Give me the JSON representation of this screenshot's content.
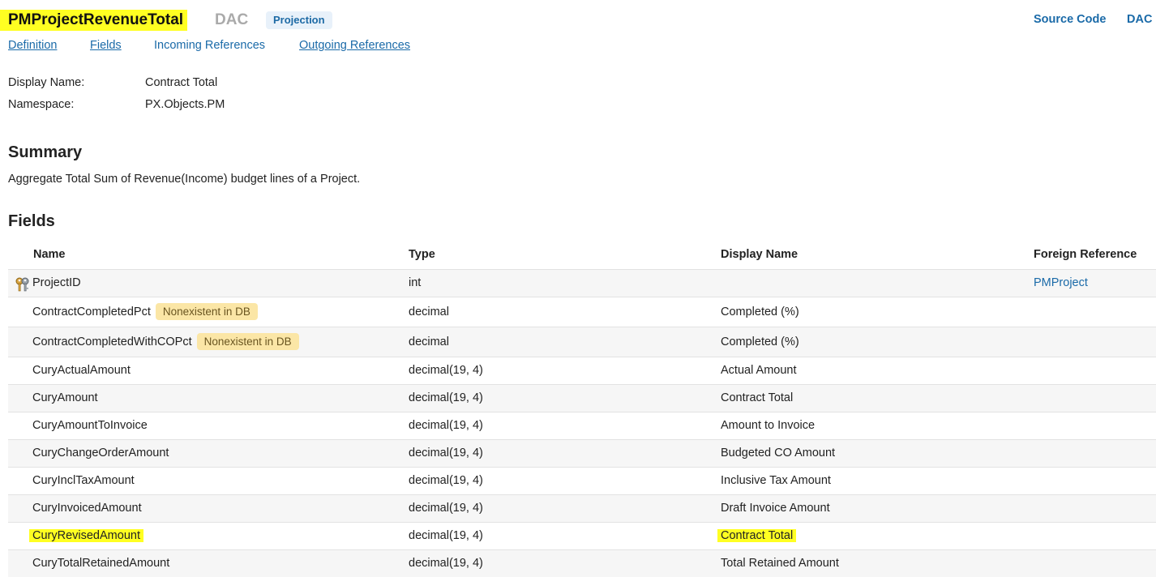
{
  "header": {
    "title": "PMProjectRevenueTotal",
    "kind": "DAC",
    "badge": "Projection",
    "source_code_link": "Source Code",
    "dac_link": "DAC"
  },
  "tabs": [
    {
      "label": "Definition"
    },
    {
      "label": "Fields"
    },
    {
      "label": "Incoming References"
    },
    {
      "label": "Outgoing References"
    }
  ],
  "properties": {
    "display_name_label": "Display Name:",
    "display_name_value": "Contract Total",
    "namespace_label": "Namespace:",
    "namespace_value": "PX.Objects.PM"
  },
  "summary": {
    "heading": "Summary",
    "text": "Aggregate Total Sum of Revenue(Income) budget lines of a Project."
  },
  "fields": {
    "heading": "Fields",
    "columns": [
      "Name",
      "Type",
      "Display Name",
      "Foreign Reference"
    ],
    "rows": [
      {
        "name": "ProjectID",
        "type": "int",
        "display": "",
        "ref": "PMProject",
        "icon": "key-icon"
      },
      {
        "name": "ContractCompletedPct",
        "badge": "Nonexistent in DB",
        "type": "decimal",
        "display": "Completed (%)",
        "ref": ""
      },
      {
        "name": "ContractCompletedWithCOPct",
        "badge": "Nonexistent in DB",
        "type": "decimal",
        "display": "Completed (%)",
        "ref": ""
      },
      {
        "name": "CuryActualAmount",
        "type": "decimal(19, 4)",
        "display": "Actual Amount",
        "ref": ""
      },
      {
        "name": "CuryAmount",
        "type": "decimal(19, 4)",
        "display": "Contract Total",
        "ref": ""
      },
      {
        "name": "CuryAmountToInvoice",
        "type": "decimal(19, 4)",
        "display": "Amount to Invoice",
        "ref": ""
      },
      {
        "name": "CuryChangeOrderAmount",
        "type": "decimal(19, 4)",
        "display": "Budgeted CO Amount",
        "ref": ""
      },
      {
        "name": "CuryInclTaxAmount",
        "type": "decimal(19, 4)",
        "display": "Inclusive Tax Amount",
        "ref": ""
      },
      {
        "name": "CuryInvoicedAmount",
        "type": "decimal(19, 4)",
        "display": "Draft Invoice Amount",
        "ref": ""
      },
      {
        "name": "CuryRevisedAmount",
        "type": "decimal(19, 4)",
        "display": "Contract Total",
        "ref": "",
        "highlighted": true
      },
      {
        "name": "CuryTotalRetainedAmount",
        "type": "decimal(19, 4)",
        "display": "Total Retained Amount",
        "ref": ""
      }
    ]
  },
  "colors": {
    "highlight": "#ffff22",
    "link": "#1a6aa8",
    "badge_bg": "#fbe6a6",
    "projection_badge_bg": "#e8f1fa"
  }
}
